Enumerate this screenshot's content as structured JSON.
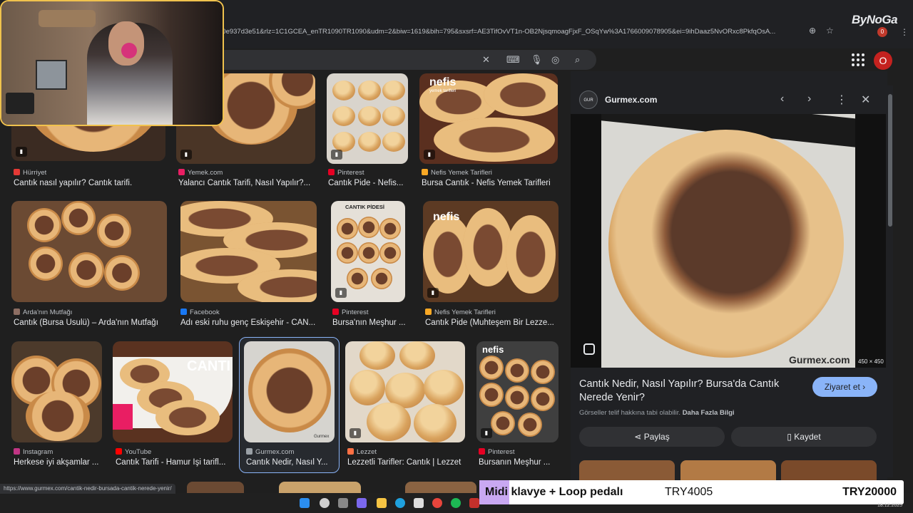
{
  "browser": {
    "url": "90e937d3e51&rlz=1C1GCEA_enTR1090TR1090&udm=2&biw=1619&bih=795&sxsrf=AE3TifOvVT1n-OB2NjsqmoagFjxF_OSqYw%3A1766009078905&ei=9ihDaaz5NvORxc8PkfqOsA...",
    "brand": "ByNoGa",
    "brand_badge": "0",
    "profile_initial": "O"
  },
  "results": [
    {
      "source": "Hürriyet",
      "title": "Cantık nasıl yapılır? Cantık tarifi.",
      "fav": "#e53935"
    },
    {
      "source": "Yemek.com",
      "title": "Yalancı Cantık Tarifi, Nasıl Yapılır?...",
      "fav": "#e91e63"
    },
    {
      "source": "Pinterest",
      "title": "Cantık Pide - Nefis...",
      "fav": "#e60023"
    },
    {
      "source": "Nefis Yemek Tarifleri",
      "title": "Bursa Cantık - Nefis Yemek Tarifleri",
      "fav": "#f9a825"
    },
    {
      "source": "Arda'nın Mutfağı",
      "title": "Cantık (Bursa Usulü) – Arda'nın Mutfağı",
      "fav": "#8d6e63"
    },
    {
      "source": "Facebook",
      "title": "Adı eski ruhu genç Eskişehir - CAN...",
      "fav": "#1877f2"
    },
    {
      "source": "Pinterest",
      "title": "Bursa'nın Meşhur ...",
      "fav": "#e60023"
    },
    {
      "source": "Nefis Yemek Tarifleri",
      "title": "Cantık Pide (Muhteşem Bir Lezze...",
      "fav": "#f9a825"
    },
    {
      "source": "Instagram",
      "title": "Herkese iyi akşamlar ...",
      "fav": "#c13584"
    },
    {
      "source": "YouTube",
      "title": "Cantık Tarifi - Hamur İşi tarifl...",
      "fav": "#ff0000"
    },
    {
      "source": "Gurmex.com",
      "title": "Cantık Nedir, Nasıl Y...",
      "fav": "#9aa0a6"
    },
    {
      "source": "Lezzet",
      "title": "Lezzetli Tarifler: Cantık | Lezzet",
      "fav": "#ff7043"
    },
    {
      "source": "Pinterest",
      "title": "Bursanın Meşhur ...",
      "fav": "#e60023"
    }
  ],
  "thumb_text": {
    "nefis": "nefis",
    "nefis_sub": "yemek tarifleri",
    "cantik_pidesi": "CANTIK PİDESİ",
    "canti": "CANTI",
    "gurmex_small": "Gurmex"
  },
  "panel": {
    "site": "Gurmex.com",
    "site_logo": "GUR MEX",
    "dims": "450 × 450",
    "watermark": "Gurmex.com",
    "title": "Cantık Nedir, Nasıl Yapılır? Bursa'da Cantık Nerede Yenir?",
    "visit": "Ziyaret et",
    "copyright": "Görseller telif hakkına tabi olabilir.",
    "learn_more": "Daha Fazla Bilgi",
    "share": "Paylaş",
    "save": "Kaydet"
  },
  "status_url": "https://www.gurmex.com/cantik-nedir-bursada-cantik-nerede-yenir/",
  "promo": {
    "title": "Midi klavye + Loop pedalı",
    "price1": "TRY4005",
    "price2": "TRY20000"
  },
  "tray_date": "18.12.2025"
}
